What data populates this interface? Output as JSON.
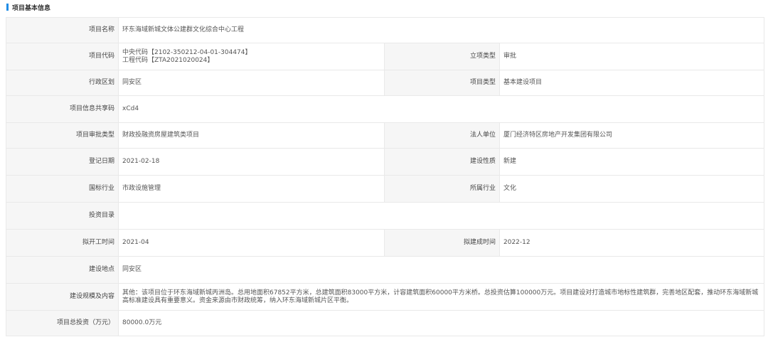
{
  "section": {
    "title": "项目基本信息",
    "accent": "#1f8ce6"
  },
  "rows": {
    "project_name": {
      "label": "项目名称",
      "value": "环东海域新城文体公建群文化综合中心工程"
    },
    "project_code": {
      "label": "项目代码",
      "value_line1": "中央代码【2102-350212-04-01-304474】",
      "value_line2": "工程代码【ZTA2021020024】",
      "label2": "立项类型",
      "value2": "审批"
    },
    "district": {
      "label": "行政区划",
      "value": "同安区",
      "label2": "项目类型",
      "value2": "基本建设项目"
    },
    "share_code": {
      "label": "项目信息共享码",
      "value": "xCd4"
    },
    "approval_type": {
      "label": "项目审批类型",
      "value": "财政投融资房屋建筑类项目",
      "label2": "法人单位",
      "value2": "厦门经济特区房地产开发集团有限公司"
    },
    "reg_date": {
      "label": "登记日期",
      "value": "2021-02-18",
      "label2": "建设性质",
      "value2": "新建"
    },
    "industry": {
      "label": "国标行业",
      "value": "市政设施管理",
      "label2": "所属行业",
      "value2": "文化"
    },
    "catalog": {
      "label": "投资目录",
      "value": ""
    },
    "start": {
      "label": "拟开工时间",
      "value": "2021-04",
      "label2": "拟建成时间",
      "value2": "2022-12"
    },
    "location": {
      "label": "建设地点",
      "value": "同安区"
    },
    "scale": {
      "label": "建设规模及内容",
      "value": "其他：该项目位于环东海域新城丙洲岛。总用地面积67852平方米，总建筑面积83000平方米，计容建筑面积60000平方米桥。总投资估算100000万元。项目建设对打造城市地标性建筑群，完善地区配套，推动环东海域新城高标准建设具有重要意义。资金来源由市财政统筹，纳入环东海域新城片区平衡。"
    },
    "investment": {
      "label": "项目总投资（万元）",
      "value": "80000.0万元"
    }
  }
}
